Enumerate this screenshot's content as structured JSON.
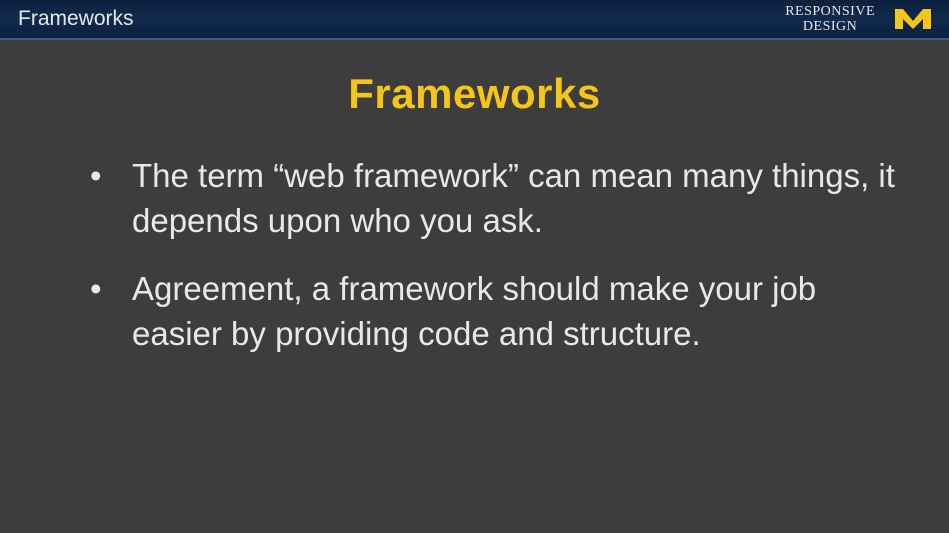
{
  "header": {
    "breadcrumb": "Frameworks",
    "course_line1": "RESPONSIVE",
    "course_line2": "DESIGN"
  },
  "slide": {
    "title": "Frameworks",
    "bullets": [
      "The term “web framework” can mean many things, it depends upon who you ask.",
      "Agreement, a framework should make your job easier by providing code and structure."
    ]
  },
  "colors": {
    "accent": "#f5c518",
    "header_bg": "#0d1f3d",
    "body_bg": "#3d3d3d",
    "text": "#e8e8e8"
  }
}
